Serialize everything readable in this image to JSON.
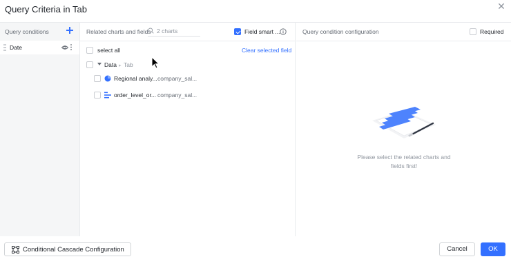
{
  "dialog": {
    "title": "Query Criteria in Tab",
    "close_icon": "close-icon"
  },
  "left": {
    "header": "Query conditions",
    "add_icon": "plus-icon",
    "conditions": [
      {
        "label": "Date"
      }
    ]
  },
  "middle": {
    "header": "Related charts and fields",
    "search_placeholder": "2 charts",
    "field_smart_label": "Field smart ...",
    "field_smart_checked": true,
    "select_all": "select all",
    "clear_selected": "Clear selected field",
    "group": {
      "name": "Data",
      "sub": "Tab"
    },
    "charts": [
      {
        "name": "Regional analy...",
        "dataset": "company_sal...",
        "icon": "pie-chart-icon"
      },
      {
        "name": "order_level_or...",
        "dataset": "company_sal...",
        "icon": "bar-chart-icon"
      }
    ]
  },
  "right": {
    "header": "Query condition configuration",
    "required_label": "Required",
    "empty_line1": "Please select the related charts and",
    "empty_line2": "fields first!"
  },
  "footer": {
    "cascade_label": "Conditional Cascade Configuration",
    "cancel_label": "Cancel",
    "ok_label": "OK"
  },
  "colors": {
    "accent": "#3370ff",
    "pane_bg": "#f5f6f7",
    "border": "#e9ebee"
  }
}
